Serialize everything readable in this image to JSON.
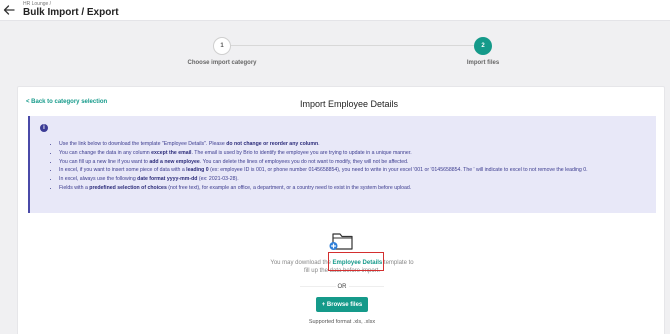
{
  "header": {
    "breadcrumb": "HR Lounge /",
    "title": "Bulk Import / Export"
  },
  "stepper": {
    "steps": [
      {
        "number": "1",
        "label": "Choose import category"
      },
      {
        "number": "2",
        "label": "Import files"
      }
    ],
    "active_step": 2,
    "accent": "#159a8a"
  },
  "main": {
    "back_link": "< Back to category selection",
    "title": "Import Employee Details",
    "info": {
      "icon": "info-icon",
      "items": [
        {
          "segments": [
            {
              "t": "Use the link below to download the template \"Employee Details\". Please "
            },
            {
              "t": "do not change or reorder any column",
              "b": true
            },
            {
              "t": "."
            }
          ]
        },
        {
          "segments": [
            {
              "t": "You can change the data in any column "
            },
            {
              "t": "except the email",
              "b": true
            },
            {
              "t": ". The email is used by Brio to identify the employee you are trying to update in a unique manner."
            }
          ]
        },
        {
          "segments": [
            {
              "t": "You can fill up a new line if you want to "
            },
            {
              "t": "add a new employee",
              "b": true
            },
            {
              "t": ". You can delete the lines of employees you do not want to modify, they will not be affected."
            }
          ]
        },
        {
          "segments": [
            {
              "t": "In excel, if you want to insert some piece of data with a "
            },
            {
              "t": "leading 0",
              "b": true
            },
            {
              "t": " (ex: employee ID is 001, or phone number 0145658854), you need to write in your excel '001 or '0145658854. The ' will indicate to excel to not remove the leading 0."
            }
          ]
        },
        {
          "segments": [
            {
              "t": "In excel, always use the following "
            },
            {
              "t": "date format yyyy-mm-dd",
              "b": true
            },
            {
              "t": " (ex: 2021-03-28)."
            }
          ]
        },
        {
          "segments": [
            {
              "t": "Fields with a "
            },
            {
              "t": "predefined selection of choices",
              "b": true
            },
            {
              "t": " (not free text), for example an office, a department, or a country need to exist in the system before upload."
            }
          ]
        }
      ]
    },
    "download": {
      "icon": "folder-upload-icon",
      "prefix": "You may download the ",
      "link": "Employee Details",
      "suffix": " template to fill up the data before import."
    },
    "or_text": "OR",
    "browse_label": "+ Browse files",
    "supported": "Supported format .xls, .xlsx"
  },
  "colors": {
    "accent": "#159a8a",
    "info_bg": "#e8e8f8",
    "info_text": "#3b3b8e",
    "highlight": "#d32f2f"
  }
}
